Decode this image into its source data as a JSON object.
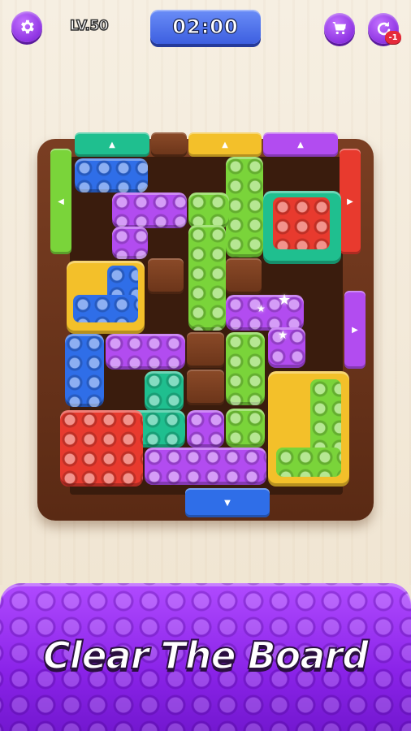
{
  "hud": {
    "level": "LV.50",
    "timer": "02:00",
    "restart_badge": "-1",
    "settings_icon": "gear-icon",
    "cart_icon": "cart-icon",
    "restart_icon": "restart-icon"
  },
  "banner": {
    "title": "Clear The Board"
  },
  "colors": {
    "purple": "#b24cf0",
    "green": "#7ad43a",
    "blue": "#2f6ee8",
    "red": "#e83a2e",
    "yellow": "#f3c02a",
    "teal": "#1fbf8f",
    "wood": "#6a3419"
  }
}
